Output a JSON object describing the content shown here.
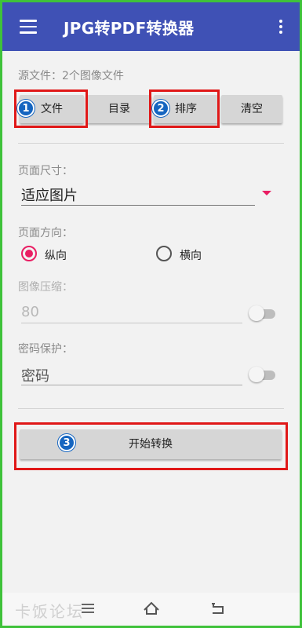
{
  "app_bar": {
    "title": "JPG转PDF转换器",
    "background": "#3f51b5",
    "menu_icon": "hamburger-menu-icon",
    "more_icon": "more-vert-icon"
  },
  "source": {
    "label": "源文件：2个图像文件",
    "buttons": [
      {
        "label": "文件",
        "badge": "1"
      },
      {
        "label": "目录"
      },
      {
        "label": "排序",
        "badge": "2"
      },
      {
        "label": "清空"
      }
    ]
  },
  "page_size": {
    "label": "页面尺寸：",
    "value": "适应图片",
    "accent": "#e91e63"
  },
  "orientation": {
    "label": "页面方向：",
    "options": [
      {
        "label": "纵向",
        "checked": true
      },
      {
        "label": "横向",
        "checked": false
      }
    ]
  },
  "compression": {
    "label": "图像压缩：",
    "placeholder": "80",
    "enabled": false
  },
  "password": {
    "label": "密码保护：",
    "placeholder": "密码",
    "enabled": false
  },
  "convert": {
    "label": "开始转换",
    "badge": "3"
  },
  "nav_bar": {
    "watermark": "卡饭论坛",
    "icons": [
      "menu-lines-icon",
      "home-icon",
      "back-icon"
    ]
  },
  "colors": {
    "highlight_box": "#e01818",
    "badge": "#1565c0",
    "frame": "#3fc23a"
  }
}
